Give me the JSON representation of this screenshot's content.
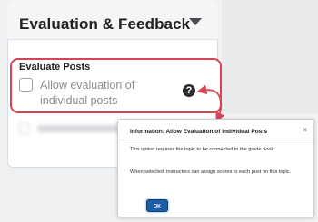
{
  "panel": {
    "title": "Evaluation & Feedback"
  },
  "evaluate_posts": {
    "section_label": "Evaluate Posts",
    "checkbox_label": "Allow evaluation of individual posts",
    "checked": false
  },
  "icons": {
    "collapse": "chevron-down-icon",
    "help": "help-icon",
    "close": "close-icon"
  },
  "dialog": {
    "title": "Information: Allow Evaluation of Individual Posts",
    "close_glyph": "×",
    "paragraph_1": "This option requires the topic to be connected to the grade book.",
    "paragraph_2": "When selected, instructors can assign scores to each post on this topic.",
    "ok_label": "OK"
  },
  "colors": {
    "highlight": "#d94452",
    "primary_button": "#1d5ea8",
    "help_icon": "#2b2d30"
  }
}
